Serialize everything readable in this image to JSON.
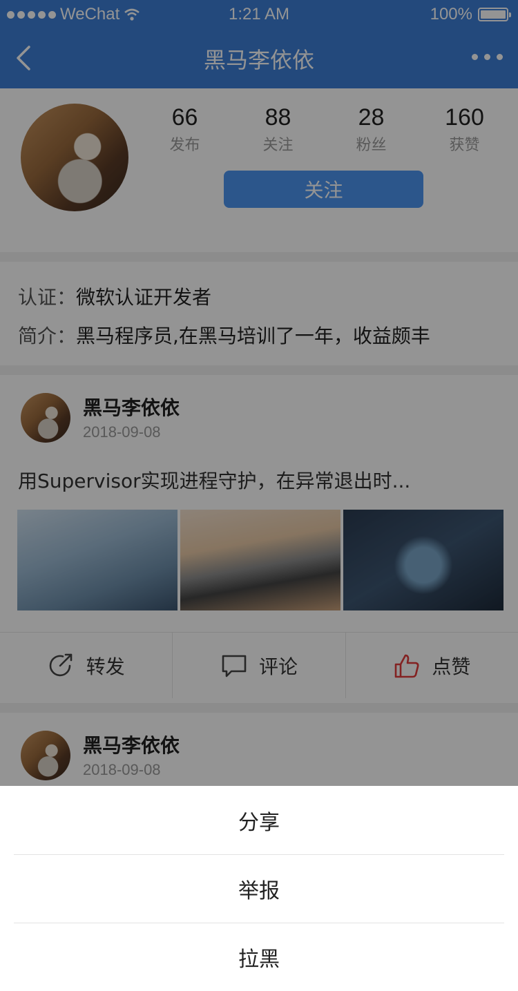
{
  "status_bar": {
    "carrier": "WeChat",
    "time": "1:21 AM",
    "battery": "100%"
  },
  "nav": {
    "title": "黑马李依依"
  },
  "profile": {
    "stats": [
      {
        "value": "66",
        "label": "发布"
      },
      {
        "value": "88",
        "label": "关注"
      },
      {
        "value": "28",
        "label": "粉丝"
      },
      {
        "value": "160",
        "label": "获赞"
      }
    ],
    "follow_label": "关注"
  },
  "info": {
    "cert_key": "认证：",
    "cert_value": "微软认证开发者",
    "bio_key": "简介：",
    "bio_value": "黑马程序员,在黑马培训了一年，收益颇丰"
  },
  "posts": [
    {
      "author": "黑马李依依",
      "date": "2018-09-08",
      "text": "用Supervisor实现进程守护，在异常退出时...",
      "actions": {
        "share": "转发",
        "comment": "评论",
        "like": "点赞"
      }
    },
    {
      "author": "黑马李依依",
      "date": "2018-09-08"
    }
  ],
  "sheet": {
    "items": [
      "分享",
      "举报",
      "拉黑"
    ]
  },
  "colors": {
    "brand": "#3d7fd6",
    "button": "#4d95ef",
    "like": "#e23b3b"
  }
}
